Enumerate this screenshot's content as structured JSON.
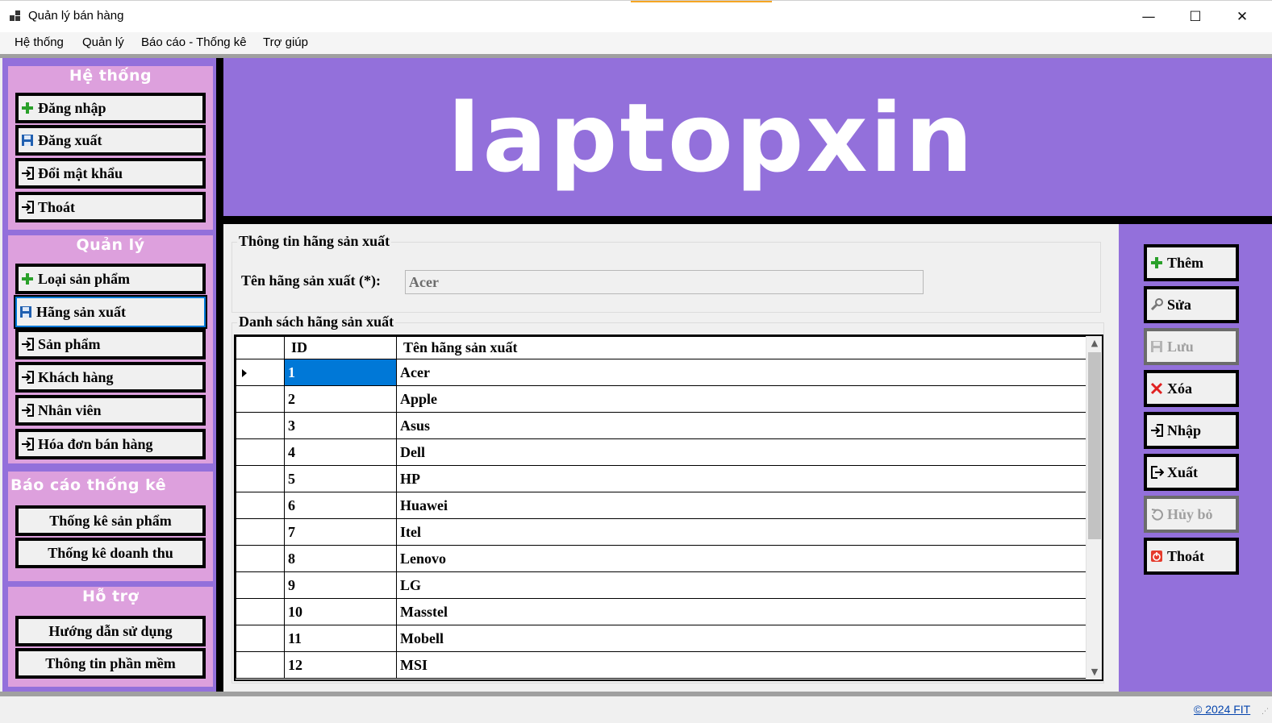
{
  "window": {
    "title": "Quản lý bán hàng",
    "minimize_glyph": "—",
    "maximize_glyph": "☐",
    "close_glyph": "✕"
  },
  "menu": [
    "Hệ thống",
    "Quản lý",
    "Báo cáo - Thống kê",
    "Trợ giúp"
  ],
  "sidebar": {
    "he_thong": {
      "title": "Hệ thống",
      "items": [
        {
          "label": "Đăng nhập",
          "icon": "plus-icon"
        },
        {
          "label": "Đăng xuất",
          "icon": "save-icon"
        },
        {
          "label": "Đổi mật khẩu",
          "icon": "login-icon"
        },
        {
          "label": "Thoát",
          "icon": "login-icon"
        }
      ]
    },
    "quan_ly": {
      "title": "Quản lý",
      "items": [
        {
          "label": "Loại sản phẩm",
          "icon": "plus-icon"
        },
        {
          "label": "Hãng sản xuất",
          "icon": "save-icon",
          "active": true
        },
        {
          "label": "Sản phẩm",
          "icon": "login-icon"
        },
        {
          "label": "Khách hàng",
          "icon": "login-icon"
        },
        {
          "label": "Nhân viên",
          "icon": "login-icon"
        },
        {
          "label": "Hóa đơn bán hàng",
          "icon": "login-icon"
        }
      ]
    },
    "bao_cao": {
      "title": "Báo cáo thống kê",
      "items": [
        "Thống kê sản phẩm",
        "Thống kê doanh thu"
      ]
    },
    "ho_tro": {
      "title": "Hỗ trợ",
      "items": [
        "Hướng dẫn sử dụng",
        "Thông tin phần mềm"
      ]
    }
  },
  "banner": {
    "title": "laptopxin"
  },
  "info": {
    "legend": "Thông tin hãng sản xuất",
    "name_label": "Tên hãng sản xuất (*):",
    "name_value": "Acer"
  },
  "list": {
    "legend": "Danh sách hãng sản xuất",
    "columns": [
      "ID",
      "Tên hãng sản xuất"
    ],
    "rows": [
      {
        "id": "1",
        "name": "Acer"
      },
      {
        "id": "2",
        "name": "Apple"
      },
      {
        "id": "3",
        "name": "Asus"
      },
      {
        "id": "4",
        "name": "Dell"
      },
      {
        "id": "5",
        "name": "HP"
      },
      {
        "id": "6",
        "name": "Huawei"
      },
      {
        "id": "7",
        "name": "Itel"
      },
      {
        "id": "8",
        "name": "Lenovo"
      },
      {
        "id": "9",
        "name": "LG"
      },
      {
        "id": "10",
        "name": "Masstel"
      },
      {
        "id": "11",
        "name": "Mobell"
      },
      {
        "id": "12",
        "name": "MSI"
      }
    ],
    "selected_row": 0
  },
  "actions": {
    "them": "Thêm",
    "sua": "Sửa",
    "luu": "Lưu",
    "xoa": "Xóa",
    "nhap": "Nhập",
    "xuat": "Xuất",
    "huy_bo": "Hủy bỏ",
    "thoat": "Thoát"
  },
  "status": {
    "copyright": "© 2024 FIT"
  },
  "colors": {
    "panel_purple": "#9370db",
    "group_plum": "#dda0dd",
    "selection_blue": "#0078d7",
    "link_blue": "#0645ad"
  }
}
